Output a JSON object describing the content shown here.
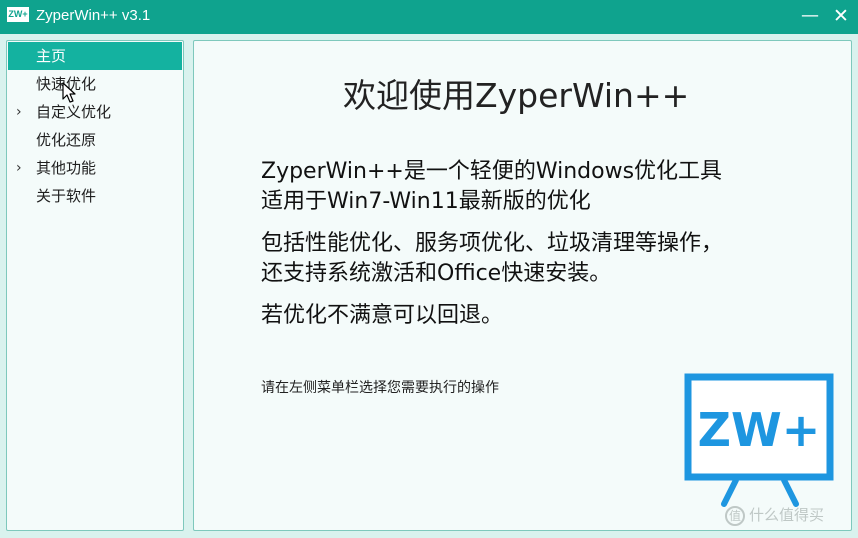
{
  "window": {
    "app_icon_text": "ZW+",
    "title": "ZyperWin++ v3.1",
    "minimize_glyph": "—",
    "close_glyph": "✕"
  },
  "sidebar": {
    "items": [
      {
        "label": "主页",
        "selected": true,
        "expandable": false
      },
      {
        "label": "快速优化",
        "selected": false,
        "expandable": false
      },
      {
        "label": "自定义优化",
        "selected": false,
        "expandable": true
      },
      {
        "label": "优化还原",
        "selected": false,
        "expandable": false
      },
      {
        "label": "其他功能",
        "selected": false,
        "expandable": true
      },
      {
        "label": "关于软件",
        "selected": false,
        "expandable": false
      }
    ],
    "expand_glyph": "›"
  },
  "main": {
    "title": "欢迎使用ZyperWin++",
    "lines": [
      "ZyperWin++是一个轻便的Windows优化工具",
      "适用于Win7-Win11最新版的优化",
      "包括性能优化、服务项优化、垃圾清理等操作，",
      "还支持系统激活和Office快速安装。",
      "若优化不满意可以回退。"
    ],
    "hint": "请在左侧菜单栏选择您需要执行的操作",
    "logo_text": "ZW+"
  },
  "watermark": {
    "icon_text": "值",
    "text": "什么值得买"
  },
  "colors": {
    "accent": "#0fa38e",
    "selected": "#14b2a0",
    "logo_blue": "#1e96e0",
    "background": "#d9f2ee"
  }
}
